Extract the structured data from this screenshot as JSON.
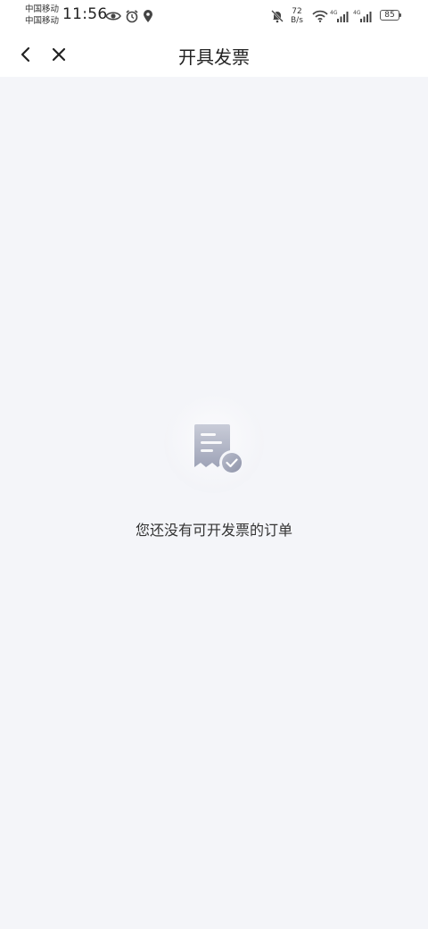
{
  "status_bar": {
    "carrier_1": "中国移动",
    "carrier_2": "中国移动",
    "time": "11:56",
    "net_speed_value": "72",
    "net_speed_unit": "B/s",
    "signal_1_label": "4G",
    "signal_2_label": "4G",
    "battery_level": "85",
    "icons": [
      "eye-icon",
      "alarm-icon",
      "location-icon",
      "mute-icon",
      "wifi-icon",
      "signal-icon",
      "signal-icon",
      "battery-icon"
    ]
  },
  "navbar": {
    "title": "开具发票",
    "back_icon": "chevron-left-icon",
    "close_icon": "close-icon"
  },
  "empty_state": {
    "icon": "receipt-check-icon",
    "message": "您还没有可开发票的订单"
  },
  "colors": {
    "background": "#f4f5f9",
    "header": "#ffffff",
    "text": "#222222",
    "illustration": "#a9adc0"
  }
}
